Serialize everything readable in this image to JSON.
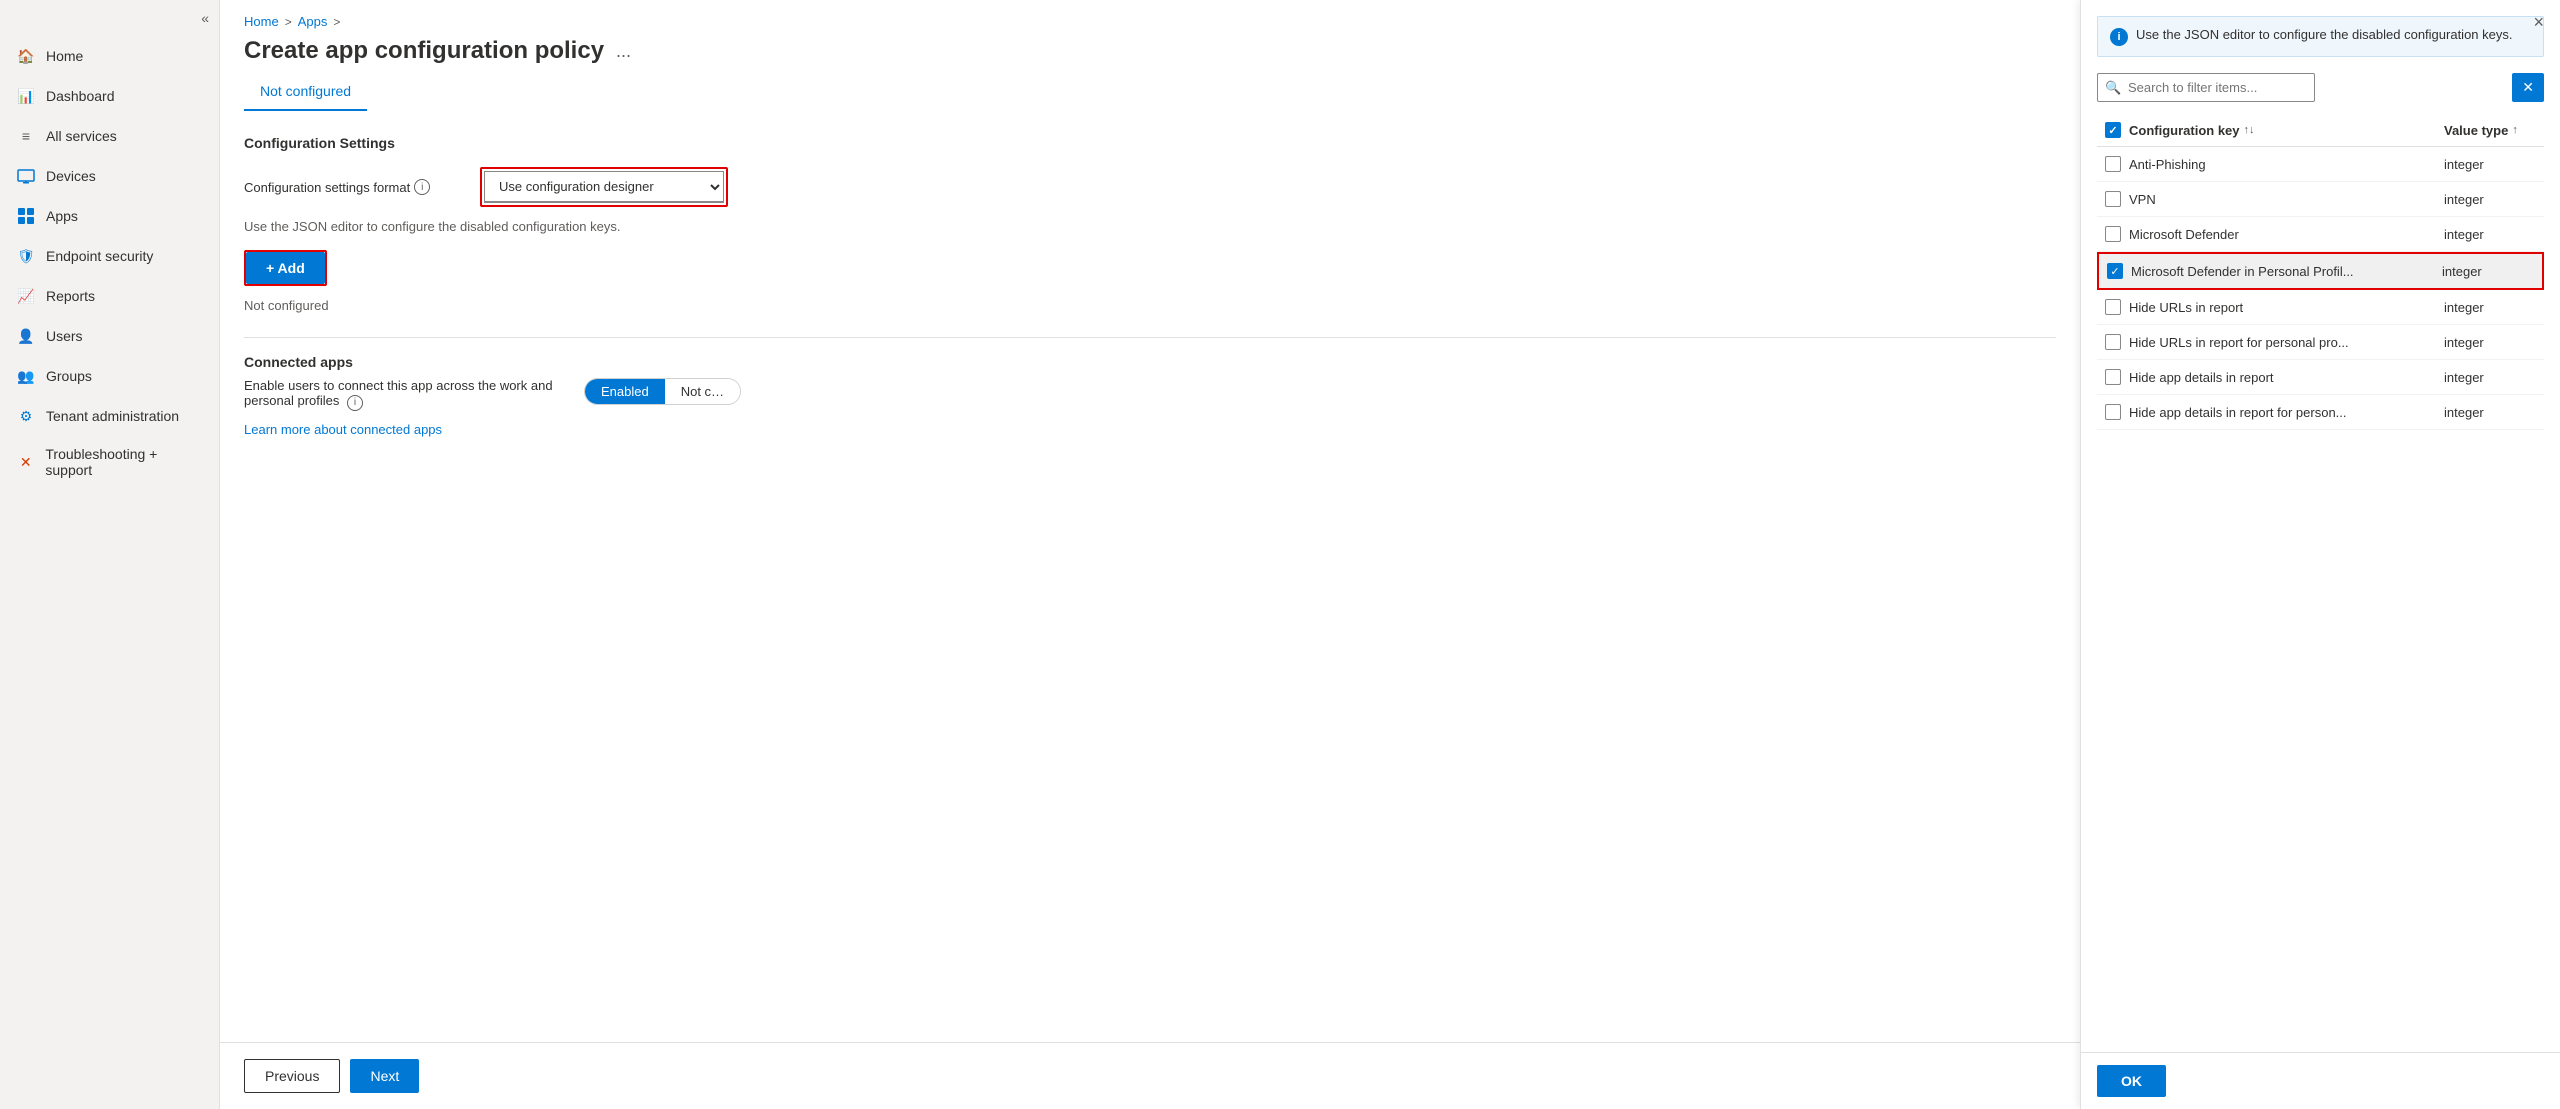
{
  "sidebar": {
    "collapse_icon": "«",
    "items": [
      {
        "id": "home",
        "label": "Home",
        "icon": "🏠"
      },
      {
        "id": "dashboard",
        "label": "Dashboard",
        "icon": "📊"
      },
      {
        "id": "allservices",
        "label": "All services",
        "icon": "≡"
      },
      {
        "id": "devices",
        "label": "Devices",
        "icon": "💻"
      },
      {
        "id": "apps",
        "label": "Apps",
        "icon": "⊞"
      },
      {
        "id": "endpoint",
        "label": "Endpoint security",
        "icon": "🛡"
      },
      {
        "id": "reports",
        "label": "Reports",
        "icon": "📈"
      },
      {
        "id": "users",
        "label": "Users",
        "icon": "👤"
      },
      {
        "id": "groups",
        "label": "Groups",
        "icon": "👥"
      },
      {
        "id": "tenant",
        "label": "Tenant administration",
        "icon": "⚙"
      },
      {
        "id": "trouble",
        "label": "Troubleshooting + support",
        "icon": "✕"
      }
    ]
  },
  "breadcrumb": {
    "home": "Home",
    "arrow1": ">",
    "apps": "Apps",
    "arrow2": ">"
  },
  "page": {
    "title": "Create app configuration policy",
    "menu_icon": "...",
    "tab_active": "Not configured"
  },
  "form": {
    "section_label": "Configuration Settings",
    "format_label": "Configuration settings format",
    "format_value": "Use configuration designer",
    "json_note": "Use the JSON editor to configure the disabled configuration keys.",
    "add_button": "+ Add",
    "not_configured": "Not configured",
    "connected_apps_title": "Connected apps",
    "connected_apps_desc": "Enable users to connect this app across the work and personal profiles",
    "toggle_enabled": "Enabled",
    "toggle_notconfigured": "Not c",
    "learn_more": "Learn more about connected apps"
  },
  "footer": {
    "previous": "Previous",
    "next": "Next"
  },
  "panel": {
    "info_message": "Use the JSON editor to configure the disabled configuration keys.",
    "search_placeholder": "Search to filter items...",
    "col_key": "Configuration key",
    "col_type": "Value type",
    "close_icon": "×",
    "ok_button": "OK",
    "rows": [
      {
        "id": "anti-phishing",
        "key": "Anti-Phishing",
        "type": "integer",
        "checked": false,
        "highlighted": false
      },
      {
        "id": "vpn",
        "key": "VPN",
        "type": "integer",
        "checked": false,
        "highlighted": false
      },
      {
        "id": "ms-defender",
        "key": "Microsoft Defender",
        "type": "integer",
        "checked": false,
        "highlighted": false
      },
      {
        "id": "ms-defender-personal",
        "key": "Microsoft Defender in Personal Profil...",
        "type": "integer",
        "checked": true,
        "highlighted": true
      },
      {
        "id": "hide-urls",
        "key": "Hide URLs in report",
        "type": "integer",
        "checked": false,
        "highlighted": false
      },
      {
        "id": "hide-urls-personal",
        "key": "Hide URLs in report for personal pro...",
        "type": "integer",
        "checked": false,
        "highlighted": false
      },
      {
        "id": "hide-app-details",
        "key": "Hide app details in report",
        "type": "integer",
        "checked": false,
        "highlighted": false
      },
      {
        "id": "hide-app-personal",
        "key": "Hide app details in report for person...",
        "type": "integer",
        "checked": false,
        "highlighted": false
      }
    ]
  }
}
